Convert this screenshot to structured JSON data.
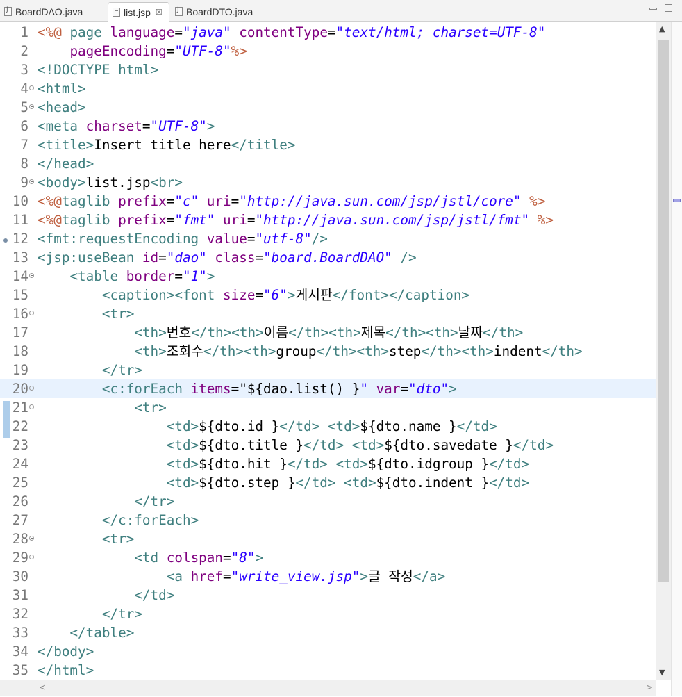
{
  "tabs": [
    {
      "label": "BoardDAO.java",
      "icon": "java-file-icon",
      "active": false
    },
    {
      "label": "list.jsp",
      "icon": "jsp-file-icon",
      "active": true,
      "close": "☒"
    },
    {
      "label": "BoardDTO.java",
      "icon": "java-file-icon",
      "active": false
    }
  ],
  "editor": {
    "current_line": 20,
    "lines": [
      {
        "n": "1",
        "segs": [
          [
            "d",
            "<%@ "
          ],
          [
            "k",
            "page "
          ],
          [
            "a",
            "language"
          ],
          [
            "t",
            "="
          ],
          [
            "v",
            "\"java\""
          ],
          [
            "t",
            " "
          ],
          [
            "a",
            "contentType"
          ],
          [
            "t",
            "="
          ],
          [
            "v",
            "\"text/html; charset=UTF-8\""
          ]
        ]
      },
      {
        "n": "2",
        "segs": [
          [
            "t",
            "    "
          ],
          [
            "a",
            "pageEncoding"
          ],
          [
            "t",
            "="
          ],
          [
            "v",
            "\"UTF-8\""
          ],
          [
            "d",
            "%>"
          ]
        ]
      },
      {
        "n": "3",
        "segs": [
          [
            "k",
            "<!DOCTYPE html>"
          ]
        ]
      },
      {
        "n": "4",
        "fold": true,
        "segs": [
          [
            "k",
            "<html>"
          ]
        ]
      },
      {
        "n": "5",
        "fold": true,
        "segs": [
          [
            "k",
            "<head>"
          ]
        ]
      },
      {
        "n": "6",
        "segs": [
          [
            "k",
            "<meta "
          ],
          [
            "a",
            "charset"
          ],
          [
            "t",
            "="
          ],
          [
            "v",
            "\"UTF-8\""
          ],
          [
            "k",
            ">"
          ]
        ]
      },
      {
        "n": "7",
        "segs": [
          [
            "k",
            "<title>"
          ],
          [
            "t",
            "Insert title here"
          ],
          [
            "k",
            "</title>"
          ]
        ]
      },
      {
        "n": "8",
        "segs": [
          [
            "k",
            "</head>"
          ]
        ]
      },
      {
        "n": "9",
        "fold": true,
        "segs": [
          [
            "k",
            "<body>"
          ],
          [
            "t",
            "list.jsp"
          ],
          [
            "k",
            "<br>"
          ]
        ]
      },
      {
        "n": "10",
        "segs": [
          [
            "d",
            "<%@"
          ],
          [
            "k",
            "taglib "
          ],
          [
            "a",
            "prefix"
          ],
          [
            "t",
            "="
          ],
          [
            "v",
            "\"c\""
          ],
          [
            "t",
            " "
          ],
          [
            "a",
            "uri"
          ],
          [
            "t",
            "="
          ],
          [
            "v",
            "\"http://java.sun.com/jsp/jstl/core\""
          ],
          [
            "t",
            " "
          ],
          [
            "d",
            "%>"
          ]
        ]
      },
      {
        "n": "11",
        "segs": [
          [
            "d",
            "<%@"
          ],
          [
            "k",
            "taglib "
          ],
          [
            "a",
            "prefix"
          ],
          [
            "t",
            "="
          ],
          [
            "v",
            "\"fmt\""
          ],
          [
            "t",
            " "
          ],
          [
            "a",
            "uri"
          ],
          [
            "t",
            "="
          ],
          [
            "v",
            "\"http://java.sun.com/jsp/jstl/fmt\""
          ],
          [
            "t",
            " "
          ],
          [
            "d",
            "%>"
          ]
        ]
      },
      {
        "n": "12",
        "segs": [
          [
            "k",
            "<fmt:requestEncoding "
          ],
          [
            "a",
            "value"
          ],
          [
            "t",
            "="
          ],
          [
            "v",
            "\"utf-8\""
          ],
          [
            "k",
            "/>"
          ]
        ]
      },
      {
        "n": "13",
        "segs": [
          [
            "k",
            "<jsp:useBean "
          ],
          [
            "a",
            "id"
          ],
          [
            "t",
            "="
          ],
          [
            "v",
            "\"dao\""
          ],
          [
            "t",
            " "
          ],
          [
            "a",
            "class"
          ],
          [
            "t",
            "="
          ],
          [
            "v",
            "\"board.BoardDAO\""
          ],
          [
            "t",
            " "
          ],
          [
            "k",
            "/>"
          ]
        ]
      },
      {
        "n": "14",
        "fold": true,
        "segs": [
          [
            "t",
            "    "
          ],
          [
            "k",
            "<table "
          ],
          [
            "a",
            "border"
          ],
          [
            "t",
            "="
          ],
          [
            "v",
            "\"1\""
          ],
          [
            "k",
            ">"
          ]
        ]
      },
      {
        "n": "15",
        "segs": [
          [
            "t",
            "        "
          ],
          [
            "k",
            "<caption><font "
          ],
          [
            "a",
            "size"
          ],
          [
            "t",
            "="
          ],
          [
            "v",
            "\"6\""
          ],
          [
            "k",
            ">"
          ],
          [
            "t",
            "게시판"
          ],
          [
            "k",
            "</font></caption>"
          ]
        ]
      },
      {
        "n": "16",
        "fold": true,
        "segs": [
          [
            "t",
            "        "
          ],
          [
            "k",
            "<tr>"
          ]
        ]
      },
      {
        "n": "17",
        "segs": [
          [
            "t",
            "            "
          ],
          [
            "k",
            "<th>"
          ],
          [
            "t",
            "번호"
          ],
          [
            "k",
            "</th><th>"
          ],
          [
            "t",
            "이름"
          ],
          [
            "k",
            "</th><th>"
          ],
          [
            "t",
            "제목"
          ],
          [
            "k",
            "</th><th>"
          ],
          [
            "t",
            "날짜"
          ],
          [
            "k",
            "</th>"
          ]
        ]
      },
      {
        "n": "18",
        "segs": [
          [
            "t",
            "            "
          ],
          [
            "k",
            "<th>"
          ],
          [
            "t",
            "조회수"
          ],
          [
            "k",
            "</th><th>"
          ],
          [
            "t",
            "group"
          ],
          [
            "k",
            "</th><th>"
          ],
          [
            "t",
            "step"
          ],
          [
            "k",
            "</th><th>"
          ],
          [
            "t",
            "indent"
          ],
          [
            "k",
            "</th>"
          ]
        ]
      },
      {
        "n": "19",
        "segs": [
          [
            "t",
            "        "
          ],
          [
            "k",
            "</tr>"
          ]
        ]
      },
      {
        "n": "20",
        "fold": true,
        "segs": [
          [
            "t",
            "        "
          ],
          [
            "k",
            "<c:forEach "
          ],
          [
            "a",
            "items"
          ],
          [
            "t",
            "=\"${dao.list() }"
          ],
          [
            "v",
            "\""
          ],
          [
            "t",
            " "
          ],
          [
            "a",
            "var"
          ],
          [
            "t",
            "="
          ],
          [
            "v",
            "\"dto\""
          ],
          [
            "k",
            ">"
          ]
        ]
      },
      {
        "n": "21",
        "fold": true,
        "segs": [
          [
            "t",
            "            "
          ],
          [
            "k",
            "<tr>"
          ]
        ]
      },
      {
        "n": "22",
        "segs": [
          [
            "t",
            "                "
          ],
          [
            "k",
            "<td>"
          ],
          [
            "t",
            "${dto.id }"
          ],
          [
            "k",
            "</td>"
          ],
          [
            "t",
            " "
          ],
          [
            "k",
            "<td>"
          ],
          [
            "t",
            "${dto.name }"
          ],
          [
            "k",
            "</td>"
          ]
        ]
      },
      {
        "n": "23",
        "segs": [
          [
            "t",
            "                "
          ],
          [
            "k",
            "<td>"
          ],
          [
            "t",
            "${dto.title }"
          ],
          [
            "k",
            "</td>"
          ],
          [
            "t",
            " "
          ],
          [
            "k",
            "<td>"
          ],
          [
            "t",
            "${dto.savedate }"
          ],
          [
            "k",
            "</td>"
          ]
        ]
      },
      {
        "n": "24",
        "segs": [
          [
            "t",
            "                "
          ],
          [
            "k",
            "<td>"
          ],
          [
            "t",
            "${dto.hit }"
          ],
          [
            "k",
            "</td>"
          ],
          [
            "t",
            " "
          ],
          [
            "k",
            "<td>"
          ],
          [
            "t",
            "${dto.idgroup }"
          ],
          [
            "k",
            "</td>"
          ]
        ]
      },
      {
        "n": "25",
        "segs": [
          [
            "t",
            "                "
          ],
          [
            "k",
            "<td>"
          ],
          [
            "t",
            "${dto.step }"
          ],
          [
            "k",
            "</td>"
          ],
          [
            "t",
            " "
          ],
          [
            "k",
            "<td>"
          ],
          [
            "t",
            "${dto.indent }"
          ],
          [
            "k",
            "</td>"
          ]
        ]
      },
      {
        "n": "26",
        "segs": [
          [
            "t",
            "            "
          ],
          [
            "k",
            "</tr>"
          ]
        ]
      },
      {
        "n": "27",
        "segs": [
          [
            "t",
            "        "
          ],
          [
            "k",
            "</c:forEach>"
          ]
        ]
      },
      {
        "n": "28",
        "fold": true,
        "segs": [
          [
            "t",
            "        "
          ],
          [
            "k",
            "<tr>"
          ]
        ]
      },
      {
        "n": "29",
        "fold": true,
        "segs": [
          [
            "t",
            "            "
          ],
          [
            "k",
            "<td "
          ],
          [
            "a",
            "colspan"
          ],
          [
            "t",
            "="
          ],
          [
            "v",
            "\"8\""
          ],
          [
            "k",
            ">"
          ]
        ]
      },
      {
        "n": "30",
        "segs": [
          [
            "t",
            "                "
          ],
          [
            "k",
            "<a "
          ],
          [
            "a",
            "href"
          ],
          [
            "t",
            "="
          ],
          [
            "v",
            "\"write_view.jsp\""
          ],
          [
            "k",
            ">"
          ],
          [
            "t",
            "글 작성"
          ],
          [
            "k",
            "</a>"
          ]
        ]
      },
      {
        "n": "31",
        "segs": [
          [
            "t",
            "            "
          ],
          [
            "k",
            "</td>"
          ]
        ]
      },
      {
        "n": "32",
        "segs": [
          [
            "t",
            "        "
          ],
          [
            "k",
            "</tr>"
          ]
        ]
      },
      {
        "n": "33",
        "segs": [
          [
            "t",
            "    "
          ],
          [
            "k",
            "</table>"
          ]
        ]
      },
      {
        "n": "34",
        "segs": [
          [
            "k",
            "</body>"
          ]
        ]
      },
      {
        "n": "35",
        "segs": [
          [
            "k",
            "</html>"
          ]
        ]
      }
    ]
  },
  "colors": {
    "tag": "#3f7f7f",
    "attribute": "#7f007f",
    "value": "#2a00ff",
    "directive": "#bf5f3f",
    "current_line_bg": "#e8f2fe"
  },
  "scroll": {
    "up": "▲",
    "down": "▼",
    "left": "<",
    "right": ">"
  }
}
